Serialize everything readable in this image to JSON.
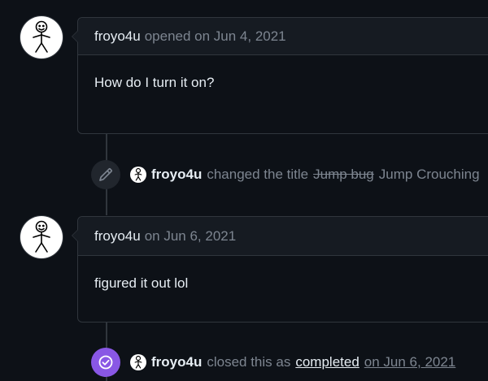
{
  "comments": [
    {
      "author": "froyo4u",
      "meta": "opened on Jun 4, 2021",
      "body": "How do I turn it on?"
    },
    {
      "author": "froyo4u",
      "meta": "on Jun 6, 2021",
      "body": "figured it out lol"
    }
  ],
  "events": {
    "title_change": {
      "icon": "pencil-icon",
      "author": "froyo4u",
      "action": "changed the title",
      "old_title": "Jump bug",
      "new_title": "Jump Crouching"
    },
    "closed": {
      "icon": "check-circle-icon",
      "author": "froyo4u",
      "action": "closed this as",
      "reason": "completed",
      "date": "on Jun 6, 2021"
    }
  },
  "colors": {
    "background": "#0d1117",
    "border": "#30363d",
    "header_bg": "#161b22",
    "closed_badge": "#8957e5",
    "muted_text": "#7d8590"
  }
}
